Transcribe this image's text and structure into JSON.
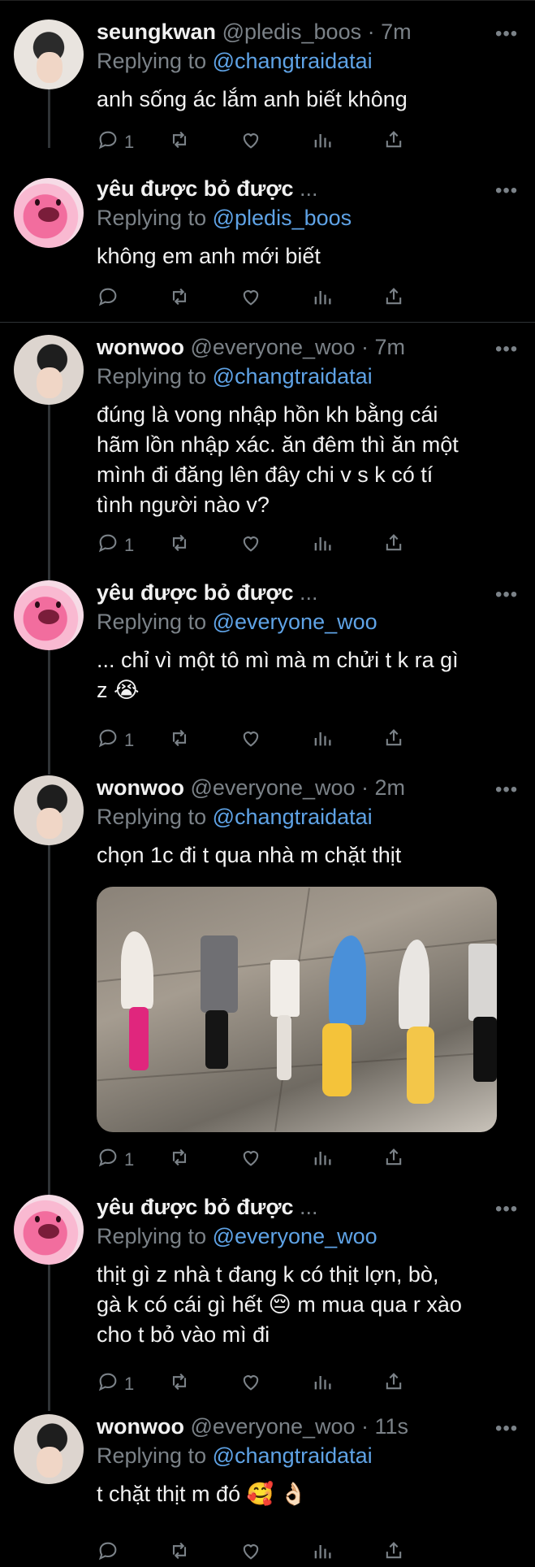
{
  "tweets": [
    {
      "name": "seungkwan",
      "handle": "@pledis_boos · 7m",
      "replying_prefix": "Replying to",
      "replying_to": "@changtraidatai",
      "text": [
        "anh sống ác lắm anh biết không"
      ],
      "reply_count": "1",
      "avatar": "boy"
    },
    {
      "name": "yêu được bỏ được",
      "handle": "...",
      "replying_prefix": "Replying to",
      "replying_to": "@pledis_boos",
      "text": [
        "không em anh mới biết"
      ],
      "reply_count": "",
      "avatar": "pink"
    },
    {
      "name": "wonwoo",
      "handle": "@everyone_woo · 7m",
      "replying_prefix": "Replying to",
      "replying_to": "@changtraidatai",
      "text": [
        "đúng là vong nhập hồn kh bằng cái",
        "hãm lồn nhập xác. ăn đêm thì ăn một",
        "mình đi đăng lên đây chi v s k có tí",
        "tình người nào v?"
      ],
      "reply_count": "1",
      "avatar": "boy2"
    },
    {
      "name": "yêu được bỏ được",
      "handle": "...",
      "replying_prefix": "Replying to",
      "replying_to": "@everyone_woo",
      "text": [
        "... chỉ vì một tô mì mà m chửi t k ra gì",
        "z 😭"
      ],
      "reply_count": "1",
      "avatar": "pink"
    },
    {
      "name": "wonwoo",
      "handle": "@everyone_woo · 2m",
      "replying_prefix": "Replying to",
      "replying_to": "@changtraidatai",
      "text": [
        "chọn 1c đi t qua nhà m chặt thịt"
      ],
      "reply_count": "1",
      "avatar": "boy2",
      "has_media": true
    },
    {
      "name": "yêu được bỏ được",
      "handle": "...",
      "replying_prefix": "Replying to",
      "replying_to": "@everyone_woo",
      "text": [
        "thịt gì z nhà t đang k có thịt lợn, bò,",
        "gà k có cái gì hết 😔  m mua qua r xào",
        "cho t bỏ vào mì đi"
      ],
      "reply_count": "1",
      "avatar": "pink"
    },
    {
      "name": "wonwoo",
      "handle": "@everyone_woo · 11s",
      "replying_prefix": "Replying to",
      "replying_to": "@changtraidatai",
      "text": [
        "t chặt thịt m đó 🥰 👌🏻"
      ],
      "reply_count": "",
      "avatar": "boy2"
    }
  ],
  "more_label": "•••",
  "colors": {
    "background": "#000000",
    "secondary_text": "#7b8288",
    "mention": "#5fa3e6"
  },
  "icons": [
    "reply-icon",
    "retweet-icon",
    "like-icon",
    "analytics-icon",
    "share-icon"
  ]
}
